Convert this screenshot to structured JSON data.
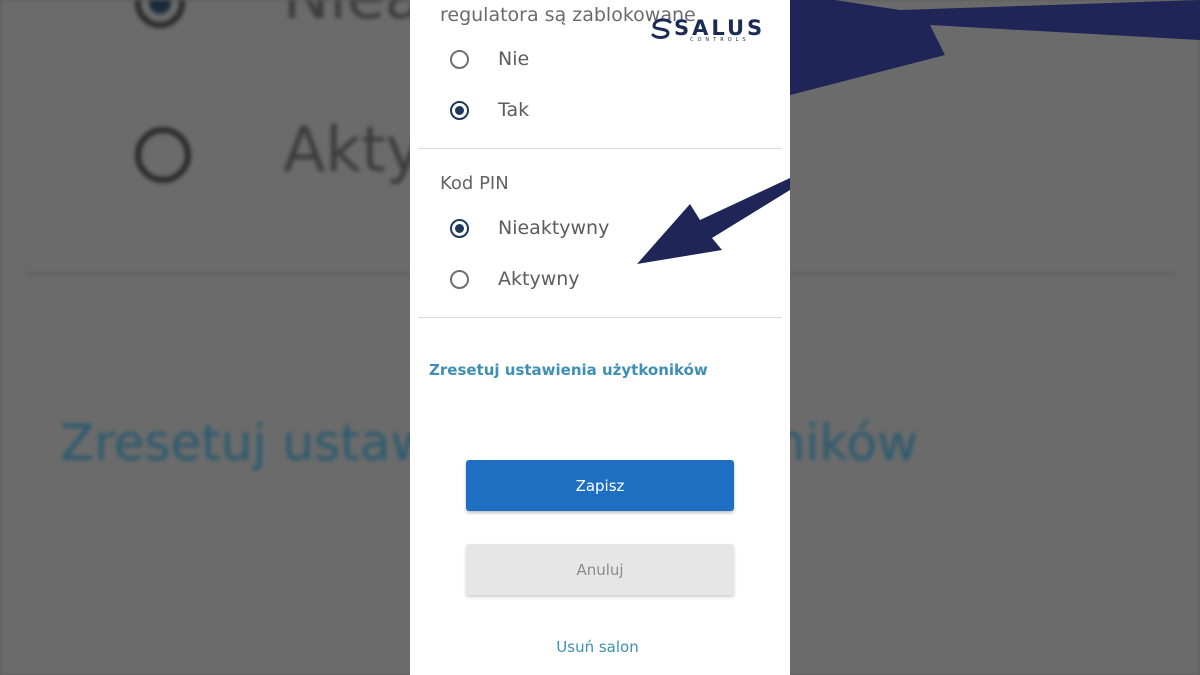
{
  "background": {
    "partial_option_top": "Nieaktywny",
    "partial_option_bottom": "Aktywny",
    "reset_link": "Zresetuj ustawienia użytkowników"
  },
  "logo": {
    "brand": "SALUS",
    "subtitle": "CONTROLS",
    "color": "#1c2b55"
  },
  "lock_section": {
    "title_cut": "regulatora są zablokowane",
    "options": [
      {
        "label": "Nie",
        "selected": false
      },
      {
        "label": "Tak",
        "selected": true
      }
    ]
  },
  "pin_section": {
    "title": "Kod PIN",
    "options": [
      {
        "label": "Nieaktywny",
        "selected": true
      },
      {
        "label": "Aktywny",
        "selected": false
      }
    ]
  },
  "reset_link": "Zresetuj ustawienia użytkoników",
  "buttons": {
    "save": "Zapisz",
    "cancel": "Anuluj"
  },
  "delete_link": "Usuń salon",
  "colors": {
    "primary": "#1e6fc2",
    "link": "#3d8fb4",
    "radio_selected": "#1c3a57",
    "arrow": "#1f2556"
  }
}
